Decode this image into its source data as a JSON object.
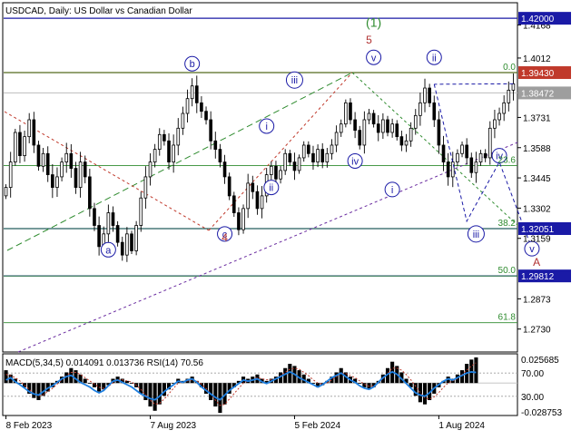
{
  "chart_data": {
    "type": "candlestick",
    "header": {
      "symbol": "USDCAD",
      "timeframe": "Daily",
      "description": "US Dollar vs Canadian Dollar"
    },
    "main_panel": {
      "y_ticks": [
        1.4168,
        1.4012,
        1.3731,
        1.3588,
        1.3445,
        1.3302,
        1.3159,
        1.2873,
        1.273
      ],
      "ylim": [
        1.263,
        1.4265
      ],
      "price_tags": [
        {
          "label": "1.42000",
          "value": 1.42,
          "color": "#1a1aa6"
        },
        {
          "label": "1.39430",
          "value": 1.3943,
          "color": "#c0392b"
        },
        {
          "label": "1.38472",
          "value": 1.3847,
          "color": "#9e9e9e"
        },
        {
          "label": "1.32051",
          "value": 1.32051,
          "color": "#1a1aa6"
        },
        {
          "label": "1.29812",
          "value": 1.29812,
          "color": "#1a1aa6"
        }
      ],
      "horizontal_levels": [
        {
          "value": 1.42,
          "color": "#1a1aa6"
        },
        {
          "value": 1.3943,
          "color": "#8b3a0a"
        },
        {
          "value": 1.32051,
          "color": "#1a1aa6"
        },
        {
          "value": 1.29812,
          "color": "#1a1aa6"
        }
      ],
      "fib_levels": [
        {
          "label": "0.0",
          "value": 1.3943
        },
        {
          "label": "23.6",
          "value": 1.3503
        },
        {
          "label": "38.2",
          "value": 1.3205
        },
        {
          "label": "50.0",
          "value": 1.2981
        },
        {
          "label": "61.8",
          "value": 1.276
        }
      ],
      "close_series": [
        1.34,
        1.352,
        1.366,
        1.355,
        1.364,
        1.372,
        1.36,
        1.35,
        1.356,
        1.346,
        1.34,
        1.345,
        1.352,
        1.356,
        1.349,
        1.34,
        1.352,
        1.345,
        1.33,
        1.322,
        1.312,
        1.318,
        1.328,
        1.322,
        1.314,
        1.308,
        1.318,
        1.31,
        1.322,
        1.335,
        1.345,
        1.352,
        1.358,
        1.365,
        1.362,
        1.352,
        1.36,
        1.368,
        1.375,
        1.382,
        1.388,
        1.38,
        1.376,
        1.372,
        1.362,
        1.358,
        1.352,
        1.345,
        1.336,
        1.328,
        1.32,
        1.33,
        1.342,
        1.338,
        1.33,
        1.336,
        1.346,
        1.35,
        1.344,
        1.348,
        1.356,
        1.352,
        1.348,
        1.354,
        1.36,
        1.356,
        1.352,
        1.358,
        1.352,
        1.356,
        1.36,
        1.366,
        1.37,
        1.38,
        1.372,
        1.367,
        1.36,
        1.372,
        1.375,
        1.37,
        1.366,
        1.372,
        1.366,
        1.37,
        1.364,
        1.36,
        1.362,
        1.368,
        1.374,
        1.38,
        1.387,
        1.38,
        1.372,
        1.36,
        1.352,
        1.345,
        1.352,
        1.356,
        1.36,
        1.354,
        1.347,
        1.352,
        1.356,
        1.354,
        1.368,
        1.372,
        1.375,
        1.38,
        1.386,
        1.389
      ],
      "wave_labels": [
        {
          "text": "a",
          "date_index": 22,
          "price": 1.3105
        },
        {
          "text": "b",
          "date_index": 40,
          "price": 1.3985
        },
        {
          "text": "c",
          "date_index": 47,
          "price": 1.318
        },
        {
          "text": "iii",
          "date_index": 62,
          "price": 1.3908
        },
        {
          "text": "i",
          "date_index": 56,
          "price": 1.369
        },
        {
          "text": "ii",
          "date_index": 57,
          "price": 1.34
        },
        {
          "text": "iv",
          "date_index": 75,
          "price": 1.3525
        },
        {
          "text": "v",
          "date_index": 79,
          "price": 1.4015
        },
        {
          "text": "i",
          "date_index": 83,
          "price": 1.339
        },
        {
          "text": "ii",
          "date_index": 92,
          "price": 1.4015
        },
        {
          "text": "iii",
          "date_index": 101,
          "price": 1.318
        },
        {
          "text": "iv",
          "date_index": 106,
          "price": 1.355
        },
        {
          "text": "v",
          "date_index": 113,
          "price": 1.311
        }
      ],
      "wave_degree_labels": [
        {
          "text": "(1)",
          "date_index": 79,
          "price": 1.416,
          "color": "#2e8b2e"
        },
        {
          "text": "5",
          "date_index": 78,
          "price": 1.408,
          "color": "#b03030"
        },
        {
          "text": "A",
          "date_index": 114,
          "price": 1.303,
          "color": "#b03030"
        },
        {
          "text": "4",
          "date_index": 47,
          "price": 1.3145,
          "color": "#b03030"
        }
      ],
      "forecast_path": [
        [
          92,
          1.3888
        ],
        [
          99,
          1.324
        ],
        [
          106,
          1.352
        ],
        [
          113,
          1.311
        ]
      ]
    },
    "indicator_panel": {
      "title": "MACD(5,34,5) 0.014091 0.013736 RSI(14) 70.56",
      "y_ticks": [
        "0.025685",
        "70.00",
        "30.00",
        "-0.028753"
      ],
      "macd": {
        "ylim": [
          -0.02875,
          0.02569
        ],
        "histogram": [
          0.012,
          0.008,
          0.004,
          0.0,
          -0.004,
          -0.01,
          -0.014,
          -0.016,
          -0.012,
          -0.008,
          -0.004,
          0.002,
          0.006,
          0.01,
          0.014,
          0.012,
          0.008,
          0.004,
          0.0,
          -0.004,
          -0.008,
          -0.006,
          -0.002,
          0.004,
          0.006,
          0.004,
          0.002,
          0.0,
          -0.004,
          -0.01,
          -0.016,
          -0.022,
          -0.026,
          -0.02,
          -0.012,
          -0.006,
          0.0,
          0.004,
          0.002,
          0.004,
          0.006,
          0.002,
          -0.004,
          -0.01,
          -0.016,
          -0.022,
          -0.028,
          -0.02,
          -0.01,
          -0.004,
          0.002,
          0.006,
          0.004,
          0.006,
          0.008,
          0.004,
          0.002,
          0.004,
          0.006,
          0.01,
          0.014,
          0.018,
          0.016,
          0.012,
          0.008,
          0.004,
          0.0,
          -0.004,
          -0.002,
          0.002,
          0.006,
          0.01,
          0.014,
          0.01,
          0.006,
          0.004,
          0.0,
          -0.004,
          -0.006,
          -0.004,
          0.002,
          0.008,
          0.014,
          0.02,
          0.016,
          0.01,
          0.004,
          -0.004,
          -0.012,
          -0.018,
          -0.02,
          -0.016,
          -0.01,
          -0.004,
          0.002,
          0.006,
          0.004,
          0.008,
          0.012,
          0.018,
          0.022,
          0.024
        ],
        "signal": [
          0.008,
          0.007,
          0.005,
          0.002,
          -0.002,
          -0.006,
          -0.01,
          -0.012,
          -0.011,
          -0.008,
          -0.005,
          -0.001,
          0.003,
          0.007,
          0.01,
          0.01,
          0.008,
          0.005,
          0.002,
          -0.001,
          -0.004,
          -0.005,
          -0.003,
          0.0,
          0.003,
          0.003,
          0.002,
          0.001,
          -0.002,
          -0.006,
          -0.011,
          -0.016,
          -0.02,
          -0.019,
          -0.015,
          -0.01,
          -0.005,
          0.0,
          0.001,
          0.002,
          0.003,
          0.002,
          -0.001,
          -0.005,
          -0.01,
          -0.016,
          -0.021,
          -0.02,
          -0.015,
          -0.01,
          -0.005,
          0.0,
          0.002,
          0.003,
          0.005,
          0.004,
          0.003,
          0.003,
          0.004,
          0.007,
          0.01,
          0.013,
          0.014,
          0.013,
          0.01,
          0.007,
          0.003,
          0.0,
          -0.001,
          0.0,
          0.003,
          0.006,
          0.009,
          0.009,
          0.007,
          0.005,
          0.002,
          -0.001,
          -0.003,
          -0.003,
          0.0,
          0.004,
          0.009,
          0.014,
          0.014,
          0.012,
          0.008,
          0.003,
          -0.003,
          -0.009,
          -0.014,
          -0.015,
          -0.013,
          -0.009,
          -0.004,
          0.0,
          0.002,
          0.004,
          0.008,
          0.012,
          0.016,
          0.019
        ]
      },
      "rsi": {
        "ylim": [
          0,
          100
        ],
        "levels": [
          70,
          30
        ],
        "values": [
          58,
          62,
          55,
          50,
          44,
          38,
          34,
          32,
          38,
          44,
          48,
          54,
          60,
          64,
          66,
          60,
          54,
          50,
          46,
          40,
          36,
          40,
          48,
          56,
          58,
          54,
          50,
          46,
          40,
          34,
          30,
          26,
          24,
          30,
          38,
          44,
          50,
          56,
          54,
          58,
          60,
          54,
          46,
          40,
          34,
          28,
          24,
          32,
          40,
          46,
          52,
          58,
          56,
          58,
          60,
          55,
          52,
          56,
          60,
          64,
          68,
          72,
          68,
          62,
          58,
          54,
          50,
          46,
          50,
          56,
          62,
          66,
          70,
          64,
          58,
          54,
          48,
          44,
          42,
          46,
          54,
          62,
          68,
          72,
          68,
          60,
          52,
          44,
          36,
          32,
          30,
          36,
          44,
          50,
          56,
          60,
          58,
          62,
          66,
          70,
          72,
          71
        ]
      }
    },
    "x_axis": {
      "labels": [
        "8 Feb 2023",
        "7 Aug 2023",
        "5 Feb 2024",
        "1 Aug 2024"
      ],
      "label_indices": [
        0,
        31,
        62,
        93
      ]
    }
  }
}
